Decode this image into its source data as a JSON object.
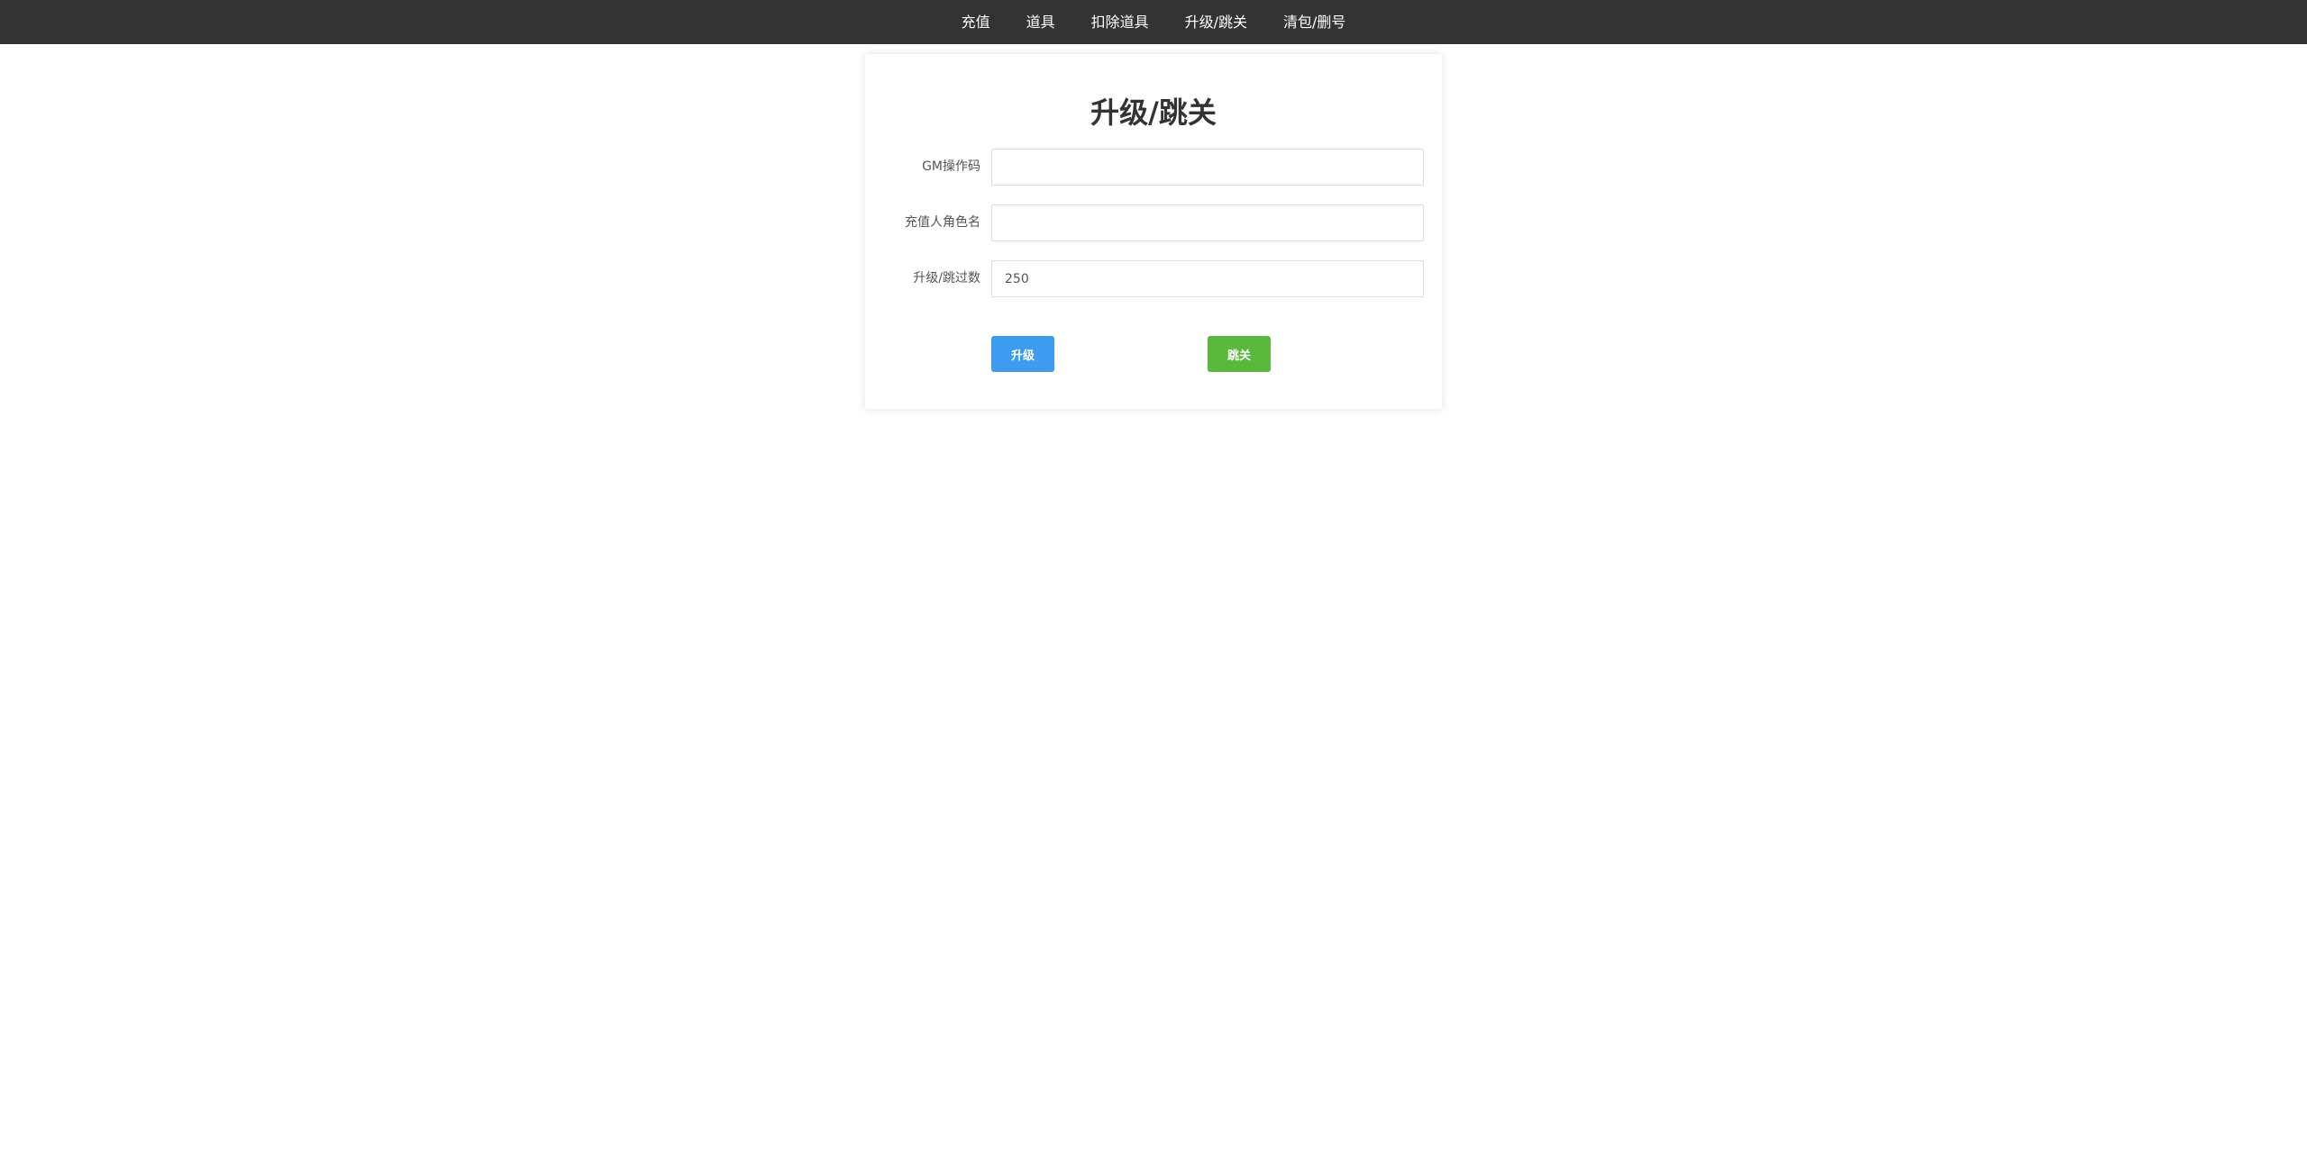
{
  "nav": {
    "items": [
      {
        "label": "充值"
      },
      {
        "label": "道具"
      },
      {
        "label": "扣除道具"
      },
      {
        "label": "升级/跳关"
      },
      {
        "label": "清包/删号"
      }
    ]
  },
  "form": {
    "title": "升级/跳关",
    "fields": [
      {
        "label": "GM操作码",
        "value": "",
        "placeholder": ""
      },
      {
        "label": "充值人角色名",
        "value": "",
        "placeholder": ""
      },
      {
        "label": "升级/跳过数",
        "value": "250",
        "placeholder": ""
      }
    ],
    "buttons": {
      "upgrade_label": "升级",
      "skip_label": "跳关"
    }
  },
  "colors": {
    "topbar": "#333333",
    "upgrade_button": "#3d9cf0",
    "skip_button": "#5ab83d"
  }
}
